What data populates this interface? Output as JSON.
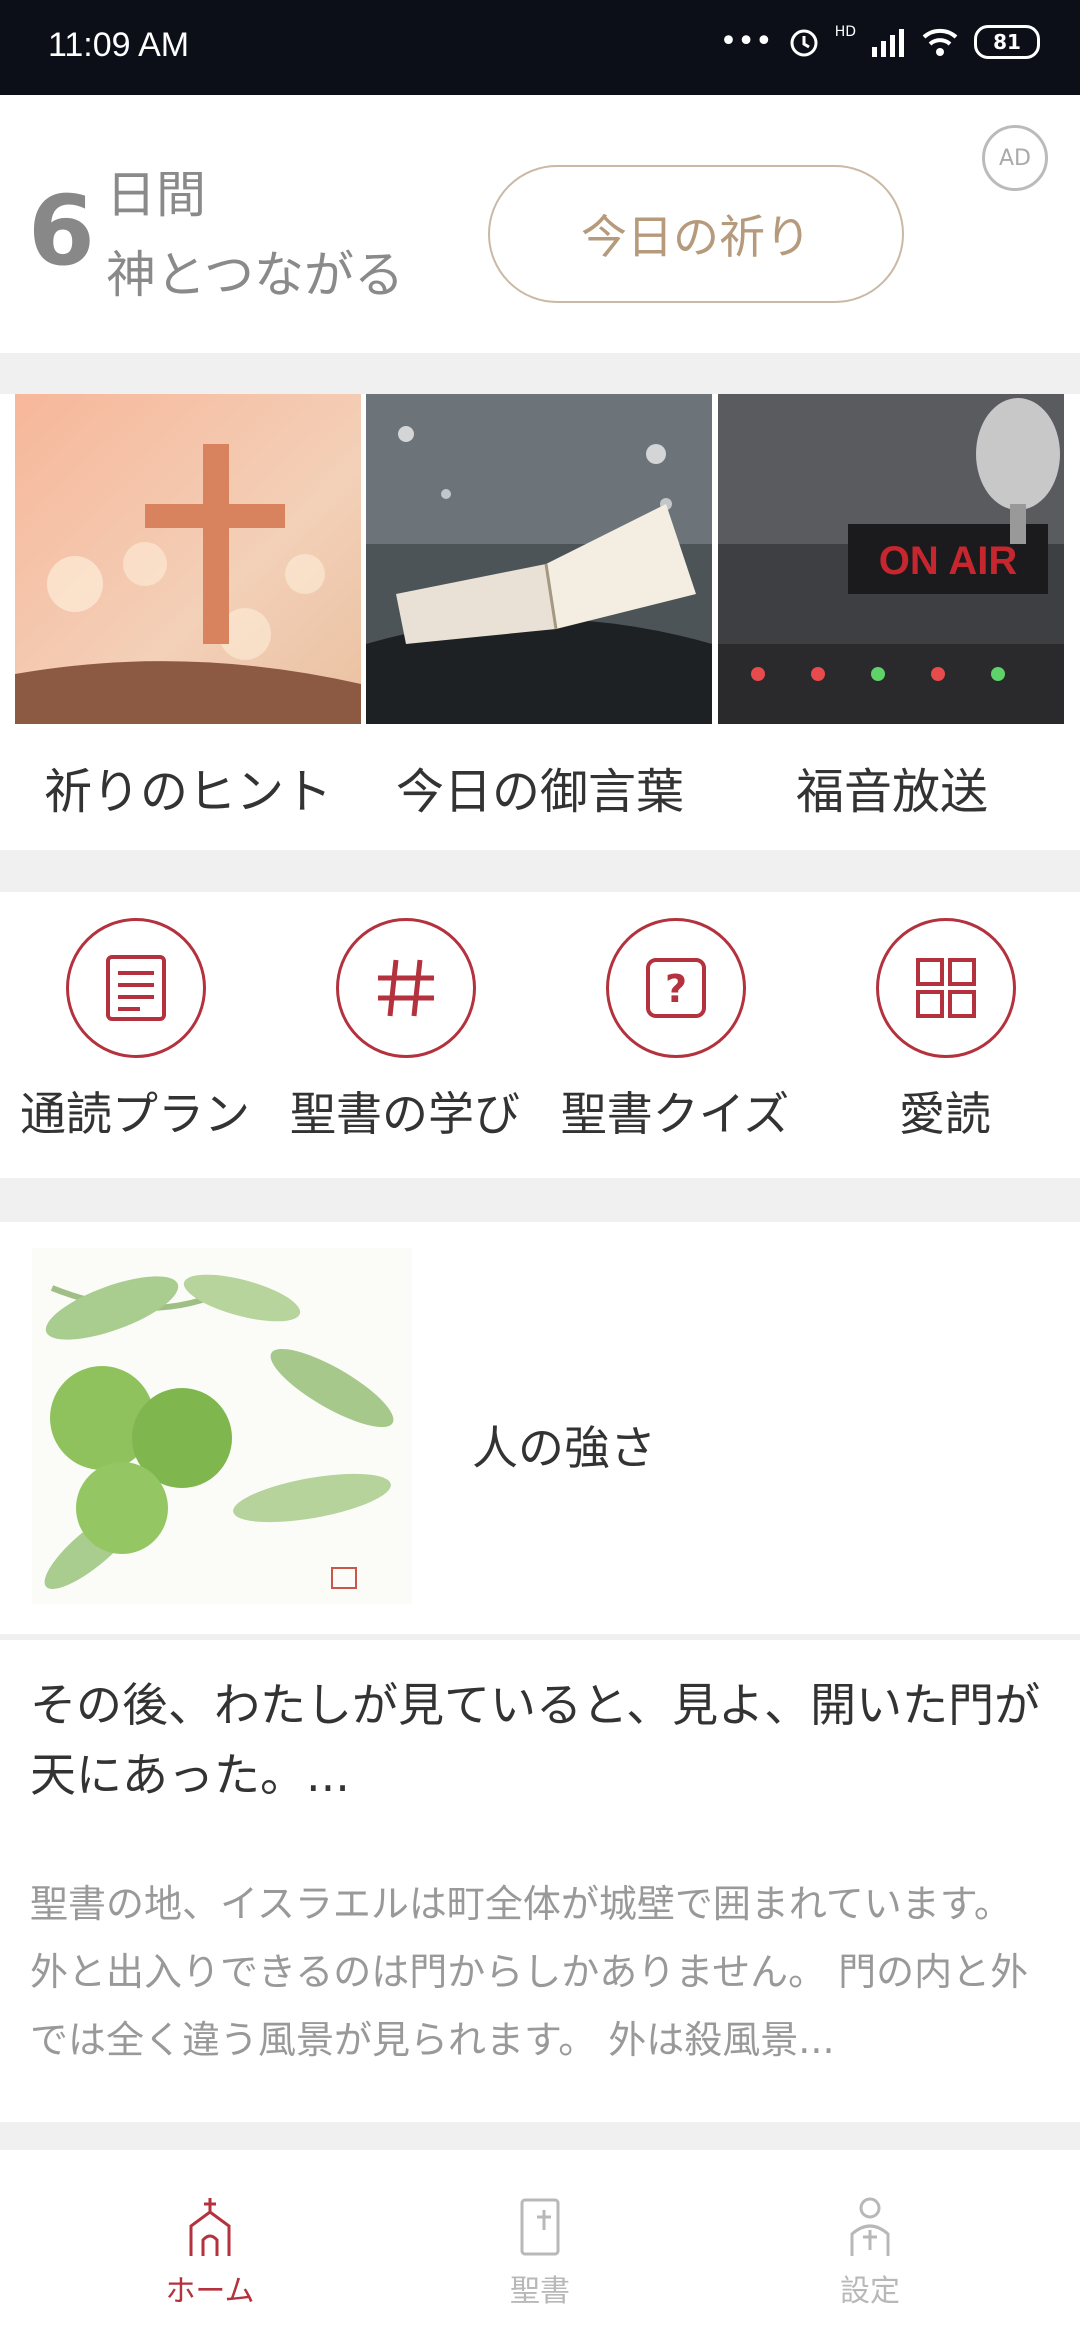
{
  "status_bar": {
    "time": "11:09 AM",
    "battery": "81",
    "signal_label": "HD"
  },
  "streak": {
    "days": "6",
    "unit": "日間",
    "caption": "神とつながる",
    "today_prayer_button": "今日の祈り",
    "ad_badge": "AD"
  },
  "media": [
    {
      "label": "祈りのヒント",
      "icon": "cross-photo"
    },
    {
      "label": "今日の御言葉",
      "icon": "bible-photo"
    },
    {
      "label": "福音放送",
      "icon": "on-air-photo",
      "sign_text": "ON AIR"
    }
  ],
  "tools": [
    {
      "label": "通読プラン",
      "icon": "document-icon"
    },
    {
      "label": "聖書の学び",
      "icon": "hash-icon"
    },
    {
      "label": "聖書クイズ",
      "icon": "quiz-icon"
    },
    {
      "label": "愛読",
      "icon": "grid-icon"
    }
  ],
  "article": {
    "title": "人の強さ",
    "verse": "その後、わたしが見ていると、見よ、開いた門が天にあった。...",
    "excerpt": "聖書の地、イスラエルは町全体が城壁で囲まれています。 外と出入りできるのは門からしかありません。 門の内と外では全く違う風景が見られます。 外は殺風景..."
  },
  "nav": [
    {
      "label": "ホーム",
      "icon": "church-icon",
      "active": true
    },
    {
      "label": "聖書",
      "icon": "bible-book-icon",
      "active": false
    },
    {
      "label": "設定",
      "icon": "settings-person-icon",
      "active": false
    }
  ],
  "colors": {
    "accent": "#b3323d",
    "button_text": "#b59a7c",
    "status_bar": "#0c0f17"
  }
}
